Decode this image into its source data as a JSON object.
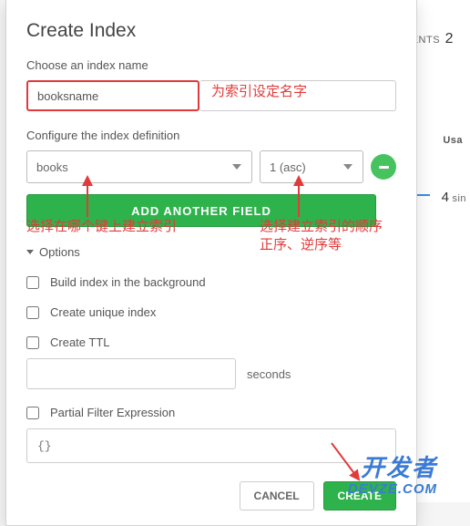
{
  "background": {
    "clients_label": "ENTS",
    "clients_value": "2",
    "usage_label": "Usa",
    "sin_value": "4",
    "sin_label": "sin"
  },
  "modal": {
    "title": "Create Index",
    "name_section": {
      "label": "Choose an index name",
      "value": "booksname"
    },
    "definition_section": {
      "label": "Configure the index definition",
      "field_value": "books",
      "order_value": "1 (asc)"
    },
    "add_field_label": "ADD ANOTHER FIELD",
    "options_label": "Options",
    "opts": {
      "background": "Build index in the background",
      "unique": "Create unique index",
      "ttl": "Create TTL",
      "seconds_label": "seconds",
      "partial": "Partial Filter Expression",
      "json_placeholder": "{}"
    },
    "footer": {
      "cancel": "CANCEL",
      "create": "CREATE"
    }
  },
  "annotations": {
    "a1": "为索引设定名字",
    "a2": "选择在哪个键上建立索引",
    "a3_l1": "选择建立索引的顺序",
    "a3_l2": "正序、逆序等"
  },
  "watermark": {
    "cn": "开发者",
    "en": "DEVZE.COM"
  },
  "colors": {
    "accent_green": "#2eb34c",
    "annotation_red": "#e13a3a",
    "link_blue": "#3a7bd5"
  }
}
